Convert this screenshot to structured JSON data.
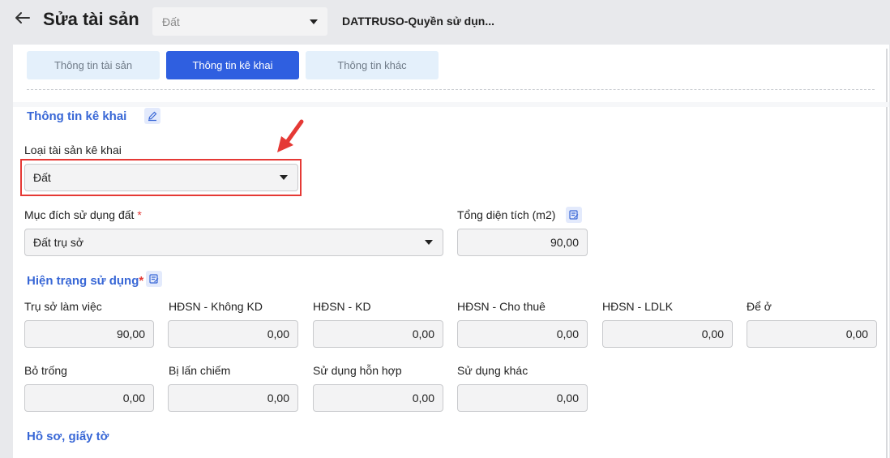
{
  "header": {
    "title": "Sửa tài sản",
    "asset_type": "Đất",
    "asset_name": "DATTRUSO-Quyền sử dụn..."
  },
  "tabs": [
    {
      "label": "Thông tin tài sản",
      "active": false
    },
    {
      "label": "Thông tin kê khai",
      "active": true
    },
    {
      "label": "Thông tin khác",
      "active": false
    }
  ],
  "declaration": {
    "section_title": "Thông tin kê khai",
    "asset_type_label": "Loại tài sản kê khai",
    "asset_type_value": "Đất",
    "purpose_label": "Mục đích sử dụng đất",
    "purpose_value": "Đất trụ sở",
    "total_area_label": "Tổng diện tích (m2)",
    "total_area_value": "90,00"
  },
  "usage": {
    "section_title": "Hiện trạng sử dụng",
    "fields": [
      {
        "label": "Trụ sở làm việc",
        "value": "90,00"
      },
      {
        "label": "HĐSN - Không KD",
        "value": "0,00"
      },
      {
        "label": "HĐSN - KD",
        "value": "0,00"
      },
      {
        "label": "HĐSN - Cho thuê",
        "value": "0,00"
      },
      {
        "label": "HĐSN - LDLK",
        "value": "0,00"
      },
      {
        "label": "Để ở",
        "value": "0,00"
      },
      {
        "label": "Bỏ trống",
        "value": "0,00"
      },
      {
        "label": "Bị lấn chiếm",
        "value": "0,00"
      },
      {
        "label": "Sử dụng hỗn hợp",
        "value": "0,00"
      },
      {
        "label": "Sử dụng khác",
        "value": "0,00"
      }
    ]
  },
  "documents": {
    "section_title": "Hồ sơ, giấy tờ"
  },
  "colors": {
    "accent": "#2f5fe0",
    "section_title": "#3867d6",
    "highlight": "#e53935"
  },
  "icons": [
    "back-arrow-icon",
    "chevron-down-icon",
    "edit-pencil-icon",
    "edit-note-icon",
    "red-pointer-arrow"
  ]
}
